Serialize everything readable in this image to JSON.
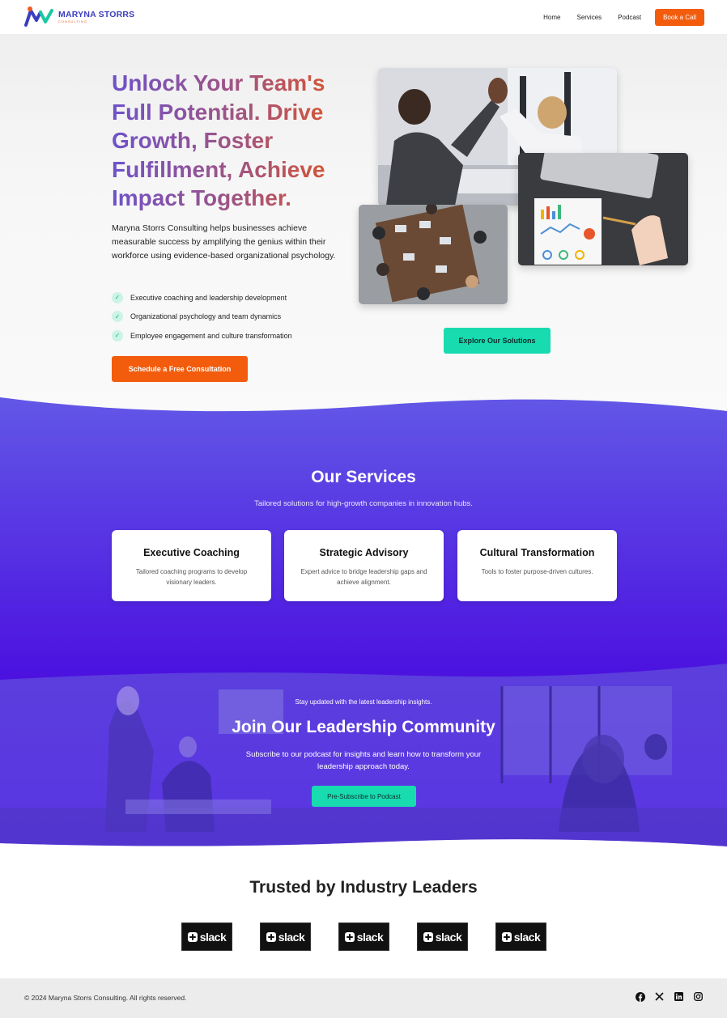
{
  "brand": {
    "name": "MARYNA STORRS",
    "sub": "CONSULTING"
  },
  "nav": {
    "items": [
      "Home",
      "Services",
      "Podcast"
    ],
    "cta": "Book a Call"
  },
  "hero": {
    "title": "Unlock Your Team's Full Potential. Drive Growth, Foster Fulfillment, Achieve Impact Together.",
    "description": "Maryna Storrs Consulting helps businesses achieve measurable success by amplifying the genius within their workforce using evidence-based organizational psychology.",
    "checks": [
      "Executive coaching and leadership development",
      "Organizational psychology and team dynamics",
      "Employee engagement and culture transformation"
    ],
    "primary_button": "Schedule a Free Consultation",
    "secondary_button": "Explore Our Solutions"
  },
  "services": {
    "title": "Our Services",
    "subtitle": "Tailored solutions for high-growth companies in innovation hubs.",
    "cards": [
      {
        "title": "Executive Coaching",
        "text": "Tailored coaching programs to develop visionary leaders."
      },
      {
        "title": "Strategic Advisory",
        "text": "Expert advice to bridge leadership gaps and achieve alignment."
      },
      {
        "title": "Cultural Transformation",
        "text": "Tools to foster purpose-driven cultures."
      }
    ]
  },
  "community": {
    "kicker": "Stay updated with the latest leadership insights.",
    "title": "Join Our Leadership Community",
    "description": "Subscribe to our podcast for insights and learn how to transform your leadership approach today.",
    "button": "Pre-Subscribe to Podcast"
  },
  "trusted": {
    "title": "Trusted by Industry Leaders",
    "logos": [
      "slack",
      "slack",
      "slack",
      "slack",
      "slack"
    ]
  },
  "footer": {
    "copyright": "© 2024 Maryna Storrs Consulting. All rights reserved.",
    "social_icons": [
      "facebook-icon",
      "x-icon",
      "linkedin-icon",
      "instagram-icon"
    ]
  },
  "colors": {
    "accent_orange": "#f25c0c",
    "accent_teal": "#18dbb0",
    "brand_purple": "#5a31e6"
  }
}
